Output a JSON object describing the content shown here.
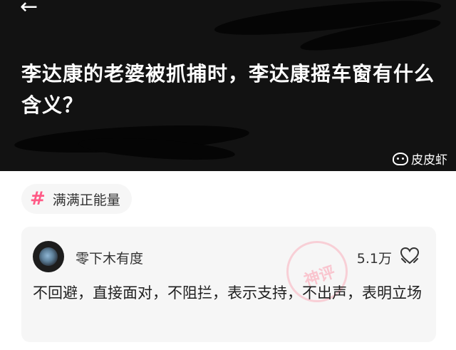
{
  "header": {
    "back_icon": "arrow-left-icon",
    "title": "李达康的老婆被抓捕时，李达康摇车窗有什么含义？",
    "watermark": "皮皮虾",
    "watermark_icon": "pipixia-logo-icon"
  },
  "tag": {
    "icon": "hash-icon",
    "label": "满满正能量",
    "color": "#ff5a86"
  },
  "comment": {
    "username": "零下木有度",
    "likes": "5.1万",
    "like_icon": "heart-hands-icon",
    "stamp": "神评",
    "text": "不回避，直接面对，不阻拦，表示支持，不出声，表明立场"
  },
  "colors": {
    "header_bg": "#121212",
    "card_bg": "#f6f6f6",
    "accent": "#ff5a86"
  }
}
